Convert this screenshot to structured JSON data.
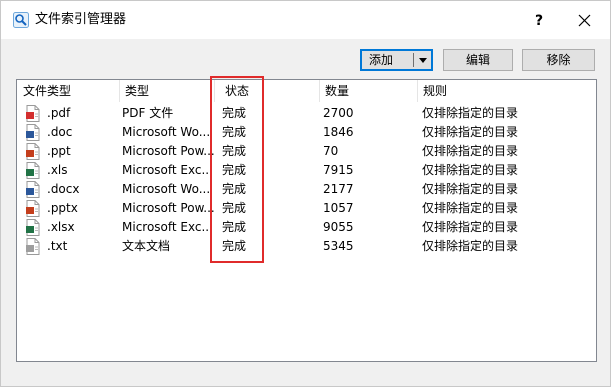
{
  "window": {
    "title": "文件索引管理器",
    "help_label": "?",
    "icons": {
      "app": "search-magnifier-icon",
      "close": "close-icon"
    }
  },
  "toolbar": {
    "add_label": "添加",
    "edit_label": "编辑",
    "remove_label": "移除"
  },
  "table": {
    "columns": [
      "文件类型",
      "类型",
      "状态",
      "数量",
      "规则"
    ],
    "rows": [
      {
        "ext": ".pdf",
        "type": "PDF 文件",
        "status": "完成",
        "count": "2700",
        "rule": "仅排除指定的目录",
        "icon": "pdf-file-icon",
        "color": "#d32f2f"
      },
      {
        "ext": ".doc",
        "type": "Microsoft Wo...",
        "status": "完成",
        "count": "1846",
        "rule": "仅排除指定的目录",
        "icon": "doc-file-icon",
        "color": "#2b579a"
      },
      {
        "ext": ".ppt",
        "type": "Microsoft Pow...",
        "status": "完成",
        "count": "70",
        "rule": "仅排除指定的目录",
        "icon": "ppt-file-icon",
        "color": "#c43e1c"
      },
      {
        "ext": ".xls",
        "type": "Microsoft Exc...",
        "status": "完成",
        "count": "7915",
        "rule": "仅排除指定的目录",
        "icon": "xls-file-icon",
        "color": "#217346"
      },
      {
        "ext": ".docx",
        "type": "Microsoft Wo...",
        "status": "完成",
        "count": "2177",
        "rule": "仅排除指定的目录",
        "icon": "docx-file-icon",
        "color": "#2b579a"
      },
      {
        "ext": ".pptx",
        "type": "Microsoft Pow...",
        "status": "完成",
        "count": "1057",
        "rule": "仅排除指定的目录",
        "icon": "pptx-file-icon",
        "color": "#c43e1c"
      },
      {
        "ext": ".xlsx",
        "type": "Microsoft Exc...",
        "status": "完成",
        "count": "9055",
        "rule": "仅排除指定的目录",
        "icon": "xlsx-file-icon",
        "color": "#217346"
      },
      {
        "ext": ".txt",
        "type": "文本文档",
        "status": "完成",
        "count": "5345",
        "rule": "仅排除指定的目录",
        "icon": "txt-file-icon",
        "color": "#9e9e9e"
      }
    ]
  },
  "annotation": {
    "highlight_color": "#e02b2b"
  }
}
